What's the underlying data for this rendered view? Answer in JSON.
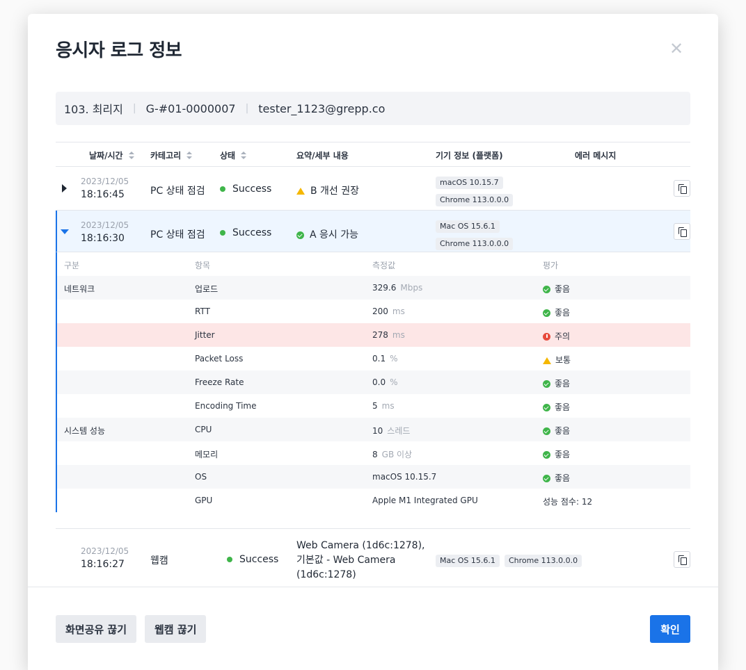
{
  "modal": {
    "title": "응시자 로그 정보",
    "close_icon": "close-icon"
  },
  "candidate": {
    "name": "103. 최리지",
    "id": "G-#01-0000007",
    "email": "tester_1123@grepp.co"
  },
  "table": {
    "headers": {
      "datetime": "날짜/시간",
      "category": "카테고리",
      "status": "상태",
      "summary": "요약/세부 내용",
      "device": "기기 정보 (플랫폼)",
      "error": "에러 메시지"
    },
    "rows": [
      {
        "date": "2023/12/05",
        "time": "18:16:45",
        "category": "PC 상태 점검",
        "status": "Success",
        "summary": "B 개선 권장",
        "summary_icon": "warning-icon",
        "device": [
          "macOS 10.15.7",
          "Chrome 113.0.0.0"
        ]
      },
      {
        "date": "2023/12/05",
        "time": "18:16:30",
        "category": "PC 상태 점검",
        "status": "Success",
        "summary": "A 응시 가능",
        "summary_icon": "check-circle-icon",
        "device": [
          "Mac OS 15.6.1",
          "Chrome 113.0.0.0"
        ]
      },
      {
        "date": "2023/12/05",
        "time": "18:16:27",
        "category": "웹캠",
        "status": "Success",
        "summary": "Web Camera (1d6c:1278), 기본값 - Web Camera (1d6c:1278)",
        "device": [
          "Mac OS 15.6.1",
          "Chrome 113.0.0.0"
        ]
      }
    ]
  },
  "detail": {
    "headers": {
      "group": "구분",
      "item": "항목",
      "value": "측정값",
      "rating": "평가"
    },
    "rows": [
      {
        "group": "네트워크",
        "item": "업로드",
        "value": "329.6",
        "unit": "Mbps",
        "rating": "좋음",
        "level": "good"
      },
      {
        "group": "",
        "item": "RTT",
        "value": "200",
        "unit": "ms",
        "rating": "좋음",
        "level": "good"
      },
      {
        "group": "",
        "item": "Jitter",
        "value": "278",
        "unit": "ms",
        "rating": "주의",
        "level": "bad"
      },
      {
        "group": "",
        "item": "Packet Loss",
        "value": "0.1",
        "unit": "%",
        "rating": "보통",
        "level": "warn"
      },
      {
        "group": "",
        "item": "Freeze Rate",
        "value": "0.0",
        "unit": "%",
        "rating": "좋음",
        "level": "good"
      },
      {
        "group": "",
        "item": "Encoding Time",
        "value": "5",
        "unit": "ms",
        "rating": "좋음",
        "level": "good"
      },
      {
        "group": "시스템 성능",
        "item": "CPU",
        "value": "10",
        "unit": "스레드",
        "rating": "좋음",
        "level": "good"
      },
      {
        "group": "",
        "item": "메모리",
        "value": "8",
        "unit": "GB 이상",
        "rating": "좋음",
        "level": "good"
      },
      {
        "group": "",
        "item": "OS",
        "value": "macOS 10.15.7",
        "unit": "",
        "rating": "좋음",
        "level": "good"
      },
      {
        "group": "",
        "item": "GPU",
        "value": "Apple M1 Integrated GPU",
        "unit": "",
        "rating": "성능 점수: 12",
        "level": "none"
      }
    ]
  },
  "footer": {
    "disconnect_screen_label": "화면공유 끊기",
    "disconnect_webcam_label": "웹캠 끊기",
    "confirm_label": "확인"
  },
  "colors": {
    "primary": "#1a73e8",
    "success": "#3fb54a",
    "warning": "#f5b700",
    "error": "#e84a3c"
  }
}
